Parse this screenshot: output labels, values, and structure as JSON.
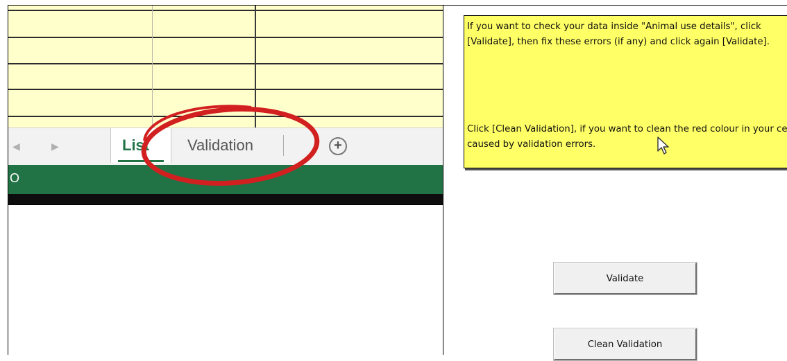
{
  "spreadsheet": {
    "sheet_tabs": [
      {
        "label": "List",
        "active": true
      },
      {
        "label": "Validation",
        "active": false
      }
    ],
    "status_text": "O",
    "add_sheet_icon": "plus-circle-icon",
    "highlight": {
      "target": "Validation tab",
      "color": "#d21f1f"
    }
  },
  "info_box": {
    "paragraph_1": "If you want to check your data inside \"Animal use details\", click [Validate], then fix these errors (if any) and click again [Validate].",
    "paragraph_2": "Click [Clean Validation], if you want to clean the red colour in your cells caused by validation errors."
  },
  "buttons": {
    "validate_label": "Validate",
    "clean_validation_label": "Clean Validation"
  },
  "colors": {
    "excel_green": "#217346",
    "cell_yellow": "#ffffcc",
    "note_yellow": "#ffff66",
    "circle_red": "#d21f1f"
  }
}
